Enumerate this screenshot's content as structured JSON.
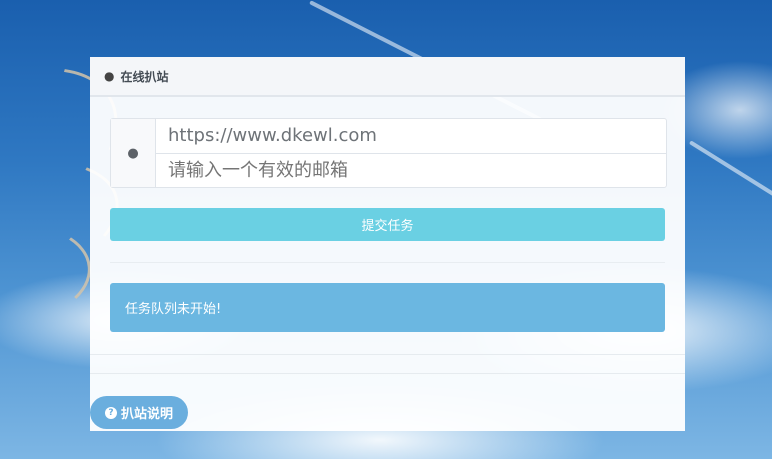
{
  "panel": {
    "title": "在线扒站",
    "title_icon": "linux-penguin-icon"
  },
  "form": {
    "addon_icon": "globe-icon",
    "url_value": "https://www.dkewl.com",
    "email_placeholder": "请输入一个有效的邮箱",
    "submit_label": "提交任务"
  },
  "status": {
    "message": "任务队列未开始!"
  },
  "help": {
    "label": "扒站说明",
    "icon": "question-circle-icon"
  },
  "colors": {
    "submit_bg": "#6ad0e3",
    "alert_bg": "#6bb7e1",
    "help_bg": "#6aaede"
  }
}
